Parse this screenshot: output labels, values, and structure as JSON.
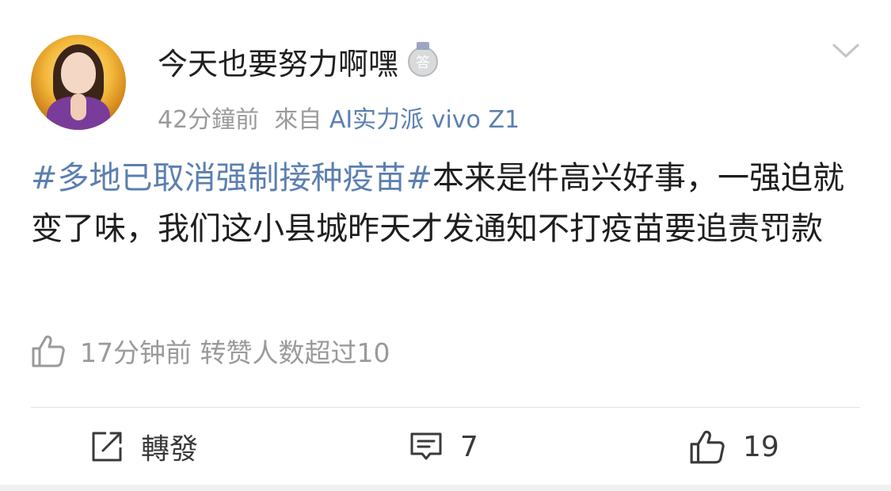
{
  "user": {
    "name": "今天也要努力啊嘿",
    "badge_icon": "medal-answer-icon"
  },
  "meta": {
    "time": "42分鐘前",
    "from_label": "來自",
    "source": "AI实力派 vivo Z1"
  },
  "post": {
    "hashtag": "#多地已取消强制接种疫苗#",
    "text": "本来是件高兴好事，一强迫就变了味，我们这小县城昨天才发通知不打疫苗要追责罚款"
  },
  "like_note": {
    "icon": "thumbs-up-icon",
    "text": "17分钟前 转赞人数超过10"
  },
  "actions": {
    "repost": {
      "icon": "share-icon",
      "label": "轉發"
    },
    "comment": {
      "icon": "comment-icon",
      "count": "7"
    },
    "like": {
      "icon": "thumbs-up-icon",
      "count": "19"
    }
  },
  "colors": {
    "link": "#5b7fb0",
    "muted": "#9a9a9a",
    "text": "#1e1e1e"
  }
}
